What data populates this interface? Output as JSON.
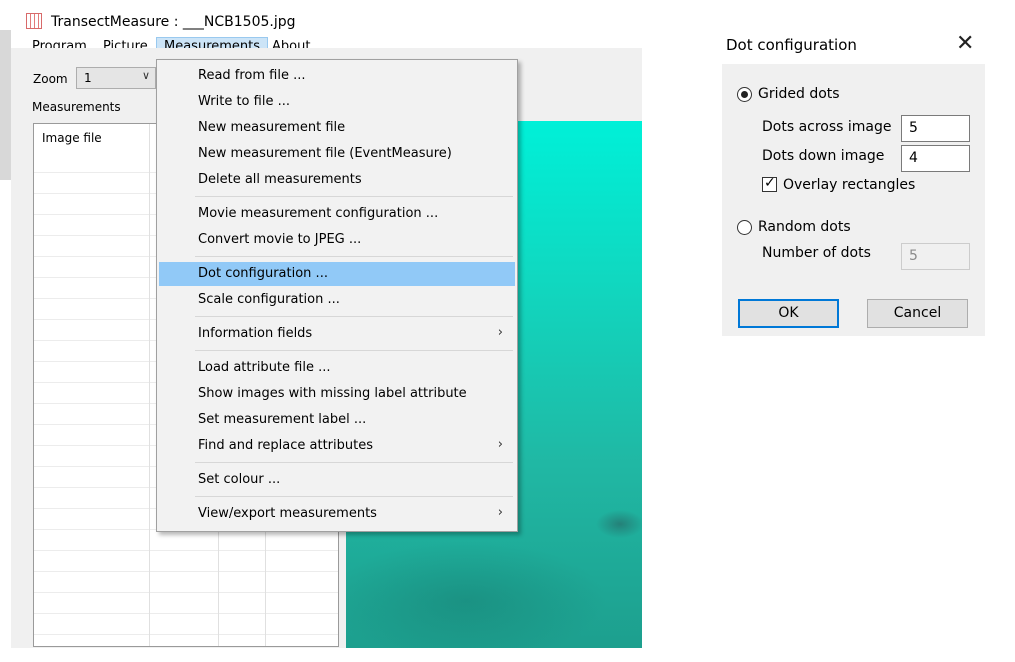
{
  "window": {
    "title": "TransectMeasure : ___NCB1505.jpg",
    "menu": [
      "Program",
      "Picture",
      "Measurements",
      "About"
    ],
    "active_menu_index": 2
  },
  "toolbar": {
    "zoom_label": "Zoom",
    "zoom_value": "1",
    "measurements_label": "Measurements"
  },
  "grid": {
    "header": "Image file"
  },
  "dropdown": {
    "items": [
      {
        "label": "Read from file ...",
        "submenu": false
      },
      {
        "label": "Write to file ...",
        "submenu": false
      },
      {
        "label": "New measurement file",
        "submenu": false
      },
      {
        "label": "New measurement file (EventMeasure)",
        "submenu": false
      },
      {
        "label": "Delete all measurements",
        "submenu": false
      },
      {
        "label": "Movie measurement configuration ...",
        "submenu": false
      },
      {
        "label": "Convert movie to JPEG ...",
        "submenu": false
      },
      {
        "label": "Dot configuration ...",
        "submenu": false,
        "highlighted": true
      },
      {
        "label": "Scale configuration ...",
        "submenu": false
      },
      {
        "label": "Information fields",
        "submenu": true
      },
      {
        "label": "Load attribute file ...",
        "submenu": false
      },
      {
        "label": "Show images with missing label attribute",
        "submenu": false
      },
      {
        "label": "Set measurement label ...",
        "submenu": false
      },
      {
        "label": "Find and replace attributes",
        "submenu": true
      },
      {
        "label": "Set colour ...",
        "submenu": false
      },
      {
        "label": "View/export measurements",
        "submenu": true
      }
    ],
    "submenu_arrow": "›"
  },
  "dialog": {
    "title": "Dot configuration",
    "close_glyph": "✕",
    "grided_label": "Grided dots",
    "grided_selected": true,
    "dots_across_label": "Dots across image",
    "dots_across_value": "5",
    "dots_down_label": "Dots down image",
    "dots_down_value": "4",
    "overlay_label": "Overlay rectangles",
    "overlay_checked": true,
    "random_label": "Random dots",
    "random_selected": false,
    "number_of_dots_label": "Number of dots",
    "number_of_dots_value": "5",
    "ok_label": "OK",
    "cancel_label": "Cancel"
  },
  "colors": {
    "menu_highlight": "#91c9f7",
    "active_menu": "#cce4f7",
    "default_button_border": "#0078d7",
    "photo_top": "#00f0d8",
    "photo_bottom": "#1d9f8e"
  }
}
